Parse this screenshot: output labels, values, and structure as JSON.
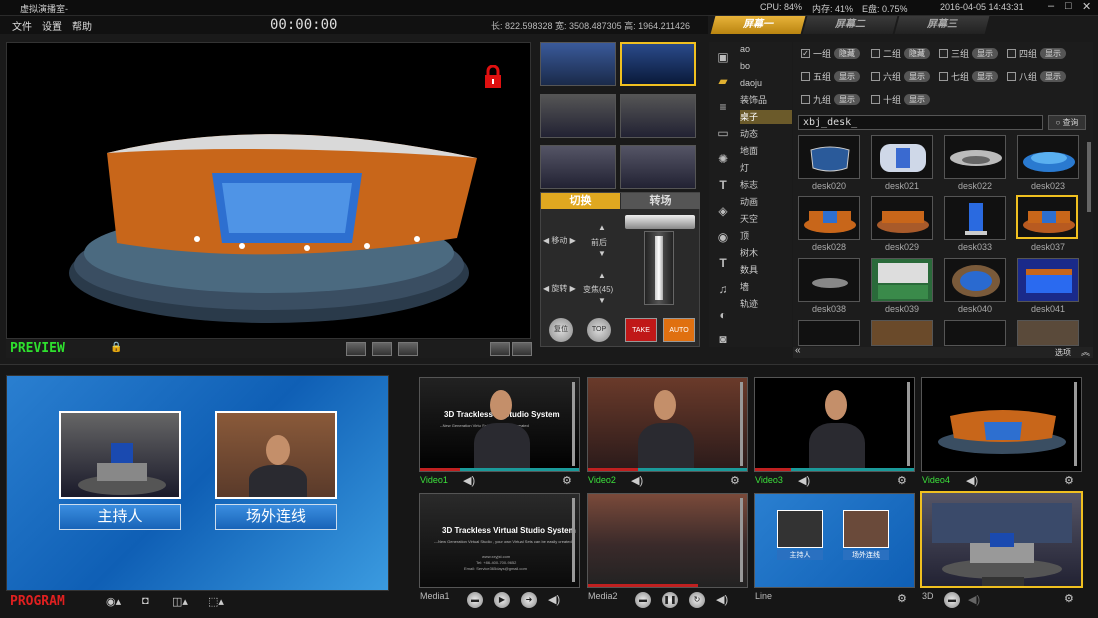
{
  "window": {
    "title": "虚拟演播室-"
  },
  "menu": {
    "file": "文件",
    "settings": "设置",
    "help": "帮助"
  },
  "timer": "00:00:00",
  "coords": "长: 822.598328  宽: 3508.487305  高: 1964.211426",
  "status": {
    "cpu": "CPU: 84%",
    "mem": "内存: 41%",
    "disk": "E盘: 0.75%",
    "datetime": "2016-04-05 14:43:31"
  },
  "screen_tabs": [
    "屏幕一",
    "屏幕二",
    "屏幕三"
  ],
  "preview": {
    "label": "PREVIEW",
    "lock_icon": "padlock-icon"
  },
  "switch": {
    "tab_cut": "切换",
    "tab_transition": "转场",
    "move": "移动",
    "forward_back": "前后",
    "rotate": "旋转",
    "zoom": "变焦(45)",
    "reset": "复位",
    "top": "TOP",
    "take": "TAKE",
    "auto": "AUTO"
  },
  "categories": [
    "ao",
    "bo",
    "daoju",
    "装饰品",
    "桌子",
    "动态",
    "地面",
    "灯",
    "标志",
    "动画",
    "天空",
    "顶",
    "树木",
    "数具",
    "墙",
    "轨迹"
  ],
  "groups": [
    {
      "label": "一组",
      "btn": "隐藏",
      "checked": true
    },
    {
      "label": "二组",
      "btn": "隐藏",
      "checked": false
    },
    {
      "label": "三组",
      "btn": "显示",
      "checked": false
    },
    {
      "label": "四组",
      "btn": "显示",
      "checked": false
    },
    {
      "label": "五组",
      "btn": "显示",
      "checked": false
    },
    {
      "label": "六组",
      "btn": "显示",
      "checked": false
    },
    {
      "label": "七组",
      "btn": "显示",
      "checked": false
    },
    {
      "label": "八组",
      "btn": "显示",
      "checked": false
    },
    {
      "label": "九组",
      "btn": "显示",
      "checked": false
    },
    {
      "label": "十组",
      "btn": "显示",
      "checked": false
    }
  ],
  "search": {
    "value": "xbj_desk_",
    "button": "查询"
  },
  "assets": [
    "desk020",
    "desk021",
    "desk022",
    "desk023",
    "desk028",
    "desk029",
    "desk033",
    "desk037",
    "desk038",
    "desk039",
    "desk040",
    "desk041"
  ],
  "asset_options": "选项",
  "program": {
    "label": "PROGRAM",
    "host": "主持人",
    "remote": "场外连线"
  },
  "sources": {
    "video1": "Video1",
    "video2": "Video2",
    "video3": "Video3",
    "video4": "Video4",
    "media1": "Media1",
    "media2": "Media2",
    "line": "Line",
    "threeD": "3D",
    "slide_title": "3D Trackless Virtual Studio System",
    "slide_sub": "---New Generation Virtual Studio , your own Virtual Sets can be easily created",
    "slide_title_short": "3D Trackless     al Studio System",
    "slide_sub_short": "--New Generation Virtu          Sets can be easily created",
    "slide_contact1": "www.xxyjst.com",
    "slide_contact2": "Tel: +86-400-700-9652",
    "slide_contact3": "Email: Service365days@gmail.com",
    "line_host": "主持人",
    "line_remote": "场外连线"
  }
}
